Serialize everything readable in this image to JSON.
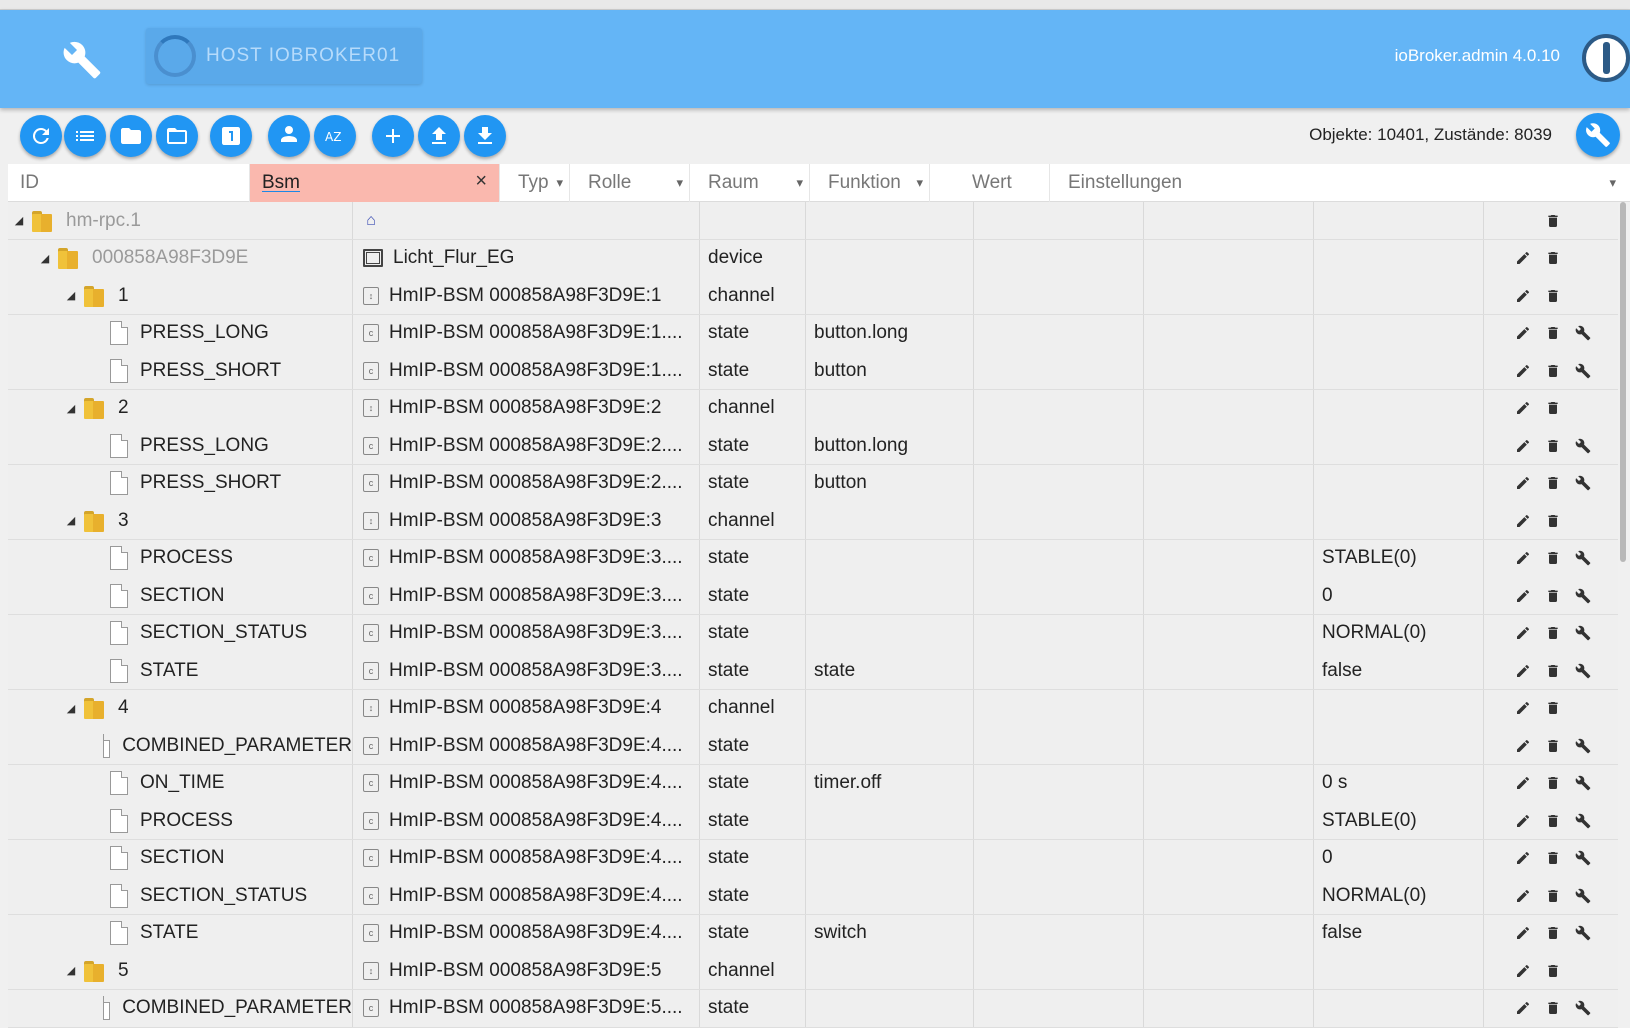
{
  "appbar": {
    "host_label": "HOST IOBROKER01",
    "version": "ioBroker.admin 4.0.10"
  },
  "toolbar": {
    "counts": "Objekte: 10401, Zustände: 8039",
    "buttons": [
      "refresh-icon",
      "list-icon",
      "folder-icon",
      "folder-open-icon",
      "number-one-icon",
      "expert-mode-icon",
      "sort-az-icon",
      "add-icon",
      "upload-icon",
      "download-icon"
    ]
  },
  "filters": {
    "id": "ID",
    "name_value": "Bsm",
    "clear": "×",
    "type": "Typ",
    "role": "Rolle",
    "room": "Raum",
    "function": "Funktion",
    "value": "Wert",
    "settings": "Einstellungen",
    "caret": "▾"
  },
  "rows": [
    {
      "level": 0,
      "kind": "folder",
      "toggle": "◢",
      "id": "hm-rpc.1",
      "muted": true,
      "name_icon": "adapter",
      "name": "",
      "type": "",
      "role": "",
      "value": "",
      "actions": [
        "delete"
      ]
    },
    {
      "level": 1,
      "kind": "folder",
      "toggle": "◢",
      "id": "000858A98F3D9E",
      "muted": true,
      "name_icon": "device",
      "name": "Licht_Flur_EG",
      "type": "device",
      "role": "",
      "value": "",
      "actions": [
        "edit",
        "delete"
      ]
    },
    {
      "level": 2,
      "kind": "folder",
      "toggle": "◢",
      "id": "1",
      "name_icon": "channel",
      "name": "HmIP-BSM 000858A98F3D9E:1",
      "type": "channel",
      "role": "",
      "value": "",
      "actions": [
        "edit",
        "delete"
      ]
    },
    {
      "level": 3,
      "kind": "file",
      "id": "PRESS_LONG",
      "name_icon": "state",
      "name": "HmIP-BSM 000858A98F3D9E:1....",
      "type": "state",
      "role": "button.long",
      "value": "",
      "actions": [
        "edit",
        "delete",
        "settings"
      ]
    },
    {
      "level": 3,
      "kind": "file",
      "id": "PRESS_SHORT",
      "name_icon": "state",
      "name": "HmIP-BSM 000858A98F3D9E:1....",
      "type": "state",
      "role": "button",
      "value": "",
      "actions": [
        "edit",
        "delete",
        "settings"
      ]
    },
    {
      "level": 2,
      "kind": "folder",
      "toggle": "◢",
      "id": "2",
      "name_icon": "channel",
      "name": "HmIP-BSM 000858A98F3D9E:2",
      "type": "channel",
      "role": "",
      "value": "",
      "actions": [
        "edit",
        "delete"
      ]
    },
    {
      "level": 3,
      "kind": "file",
      "id": "PRESS_LONG",
      "name_icon": "state",
      "name": "HmIP-BSM 000858A98F3D9E:2....",
      "type": "state",
      "role": "button.long",
      "value": "",
      "actions": [
        "edit",
        "delete",
        "settings"
      ]
    },
    {
      "level": 3,
      "kind": "file",
      "id": "PRESS_SHORT",
      "name_icon": "state",
      "name": "HmIP-BSM 000858A98F3D9E:2....",
      "type": "state",
      "role": "button",
      "value": "",
      "actions": [
        "edit",
        "delete",
        "settings"
      ]
    },
    {
      "level": 2,
      "kind": "folder",
      "toggle": "◢",
      "id": "3",
      "name_icon": "channel",
      "name": "HmIP-BSM 000858A98F3D9E:3",
      "type": "channel",
      "role": "",
      "value": "",
      "actions": [
        "edit",
        "delete"
      ]
    },
    {
      "level": 3,
      "kind": "file",
      "id": "PROCESS",
      "name_icon": "state",
      "name": "HmIP-BSM 000858A98F3D9E:3....",
      "type": "state",
      "role": "",
      "value": "STABLE(0)",
      "actions": [
        "edit",
        "delete",
        "settings"
      ]
    },
    {
      "level": 3,
      "kind": "file",
      "id": "SECTION",
      "name_icon": "state",
      "name": "HmIP-BSM 000858A98F3D9E:3....",
      "type": "state",
      "role": "",
      "value": "0",
      "actions": [
        "edit",
        "delete",
        "settings"
      ]
    },
    {
      "level": 3,
      "kind": "file",
      "id": "SECTION_STATUS",
      "name_icon": "state",
      "name": "HmIP-BSM 000858A98F3D9E:3....",
      "type": "state",
      "role": "",
      "value": "NORMAL(0)",
      "actions": [
        "edit",
        "delete",
        "settings"
      ]
    },
    {
      "level": 3,
      "kind": "file",
      "id": "STATE",
      "name_icon": "state",
      "name": "HmIP-BSM 000858A98F3D9E:3....",
      "type": "state",
      "role": "state",
      "value": "false",
      "actions": [
        "edit",
        "delete",
        "settings"
      ]
    },
    {
      "level": 2,
      "kind": "folder",
      "toggle": "◢",
      "id": "4",
      "name_icon": "channel",
      "name": "HmIP-BSM 000858A98F3D9E:4",
      "type": "channel",
      "role": "",
      "value": "",
      "actions": [
        "edit",
        "delete"
      ]
    },
    {
      "level": 3,
      "kind": "file",
      "id": "COMBINED_PARAMETER",
      "name_icon": "state",
      "name": "HmIP-BSM 000858A98F3D9E:4....",
      "type": "state",
      "role": "",
      "value": "",
      "actions": [
        "edit",
        "delete",
        "settings"
      ]
    },
    {
      "level": 3,
      "kind": "file",
      "id": "ON_TIME",
      "name_icon": "state",
      "name": "HmIP-BSM 000858A98F3D9E:4....",
      "type": "state",
      "role": "timer.off",
      "value": "0 s",
      "actions": [
        "edit",
        "delete",
        "settings"
      ]
    },
    {
      "level": 3,
      "kind": "file",
      "id": "PROCESS",
      "name_icon": "state",
      "name": "HmIP-BSM 000858A98F3D9E:4....",
      "type": "state",
      "role": "",
      "value": "STABLE(0)",
      "actions": [
        "edit",
        "delete",
        "settings"
      ]
    },
    {
      "level": 3,
      "kind": "file",
      "id": "SECTION",
      "name_icon": "state",
      "name": "HmIP-BSM 000858A98F3D9E:4....",
      "type": "state",
      "role": "",
      "value": "0",
      "actions": [
        "edit",
        "delete",
        "settings"
      ]
    },
    {
      "level": 3,
      "kind": "file",
      "id": "SECTION_STATUS",
      "name_icon": "state",
      "name": "HmIP-BSM 000858A98F3D9E:4....",
      "type": "state",
      "role": "",
      "value": "NORMAL(0)",
      "actions": [
        "edit",
        "delete",
        "settings"
      ]
    },
    {
      "level": 3,
      "kind": "file",
      "id": "STATE",
      "name_icon": "state",
      "name": "HmIP-BSM 000858A98F3D9E:4....",
      "type": "state",
      "role": "switch",
      "value": "false",
      "actions": [
        "edit",
        "delete",
        "settings"
      ]
    },
    {
      "level": 2,
      "kind": "folder",
      "toggle": "◢",
      "id": "5",
      "name_icon": "channel",
      "name": "HmIP-BSM 000858A98F3D9E:5",
      "type": "channel",
      "role": "",
      "value": "",
      "actions": [
        "edit",
        "delete"
      ]
    },
    {
      "level": 3,
      "kind": "file",
      "id": "COMBINED_PARAMETER",
      "name_icon": "state",
      "name": "HmIP-BSM 000858A98F3D9E:5....",
      "type": "state",
      "role": "",
      "value": "",
      "actions": [
        "edit",
        "delete",
        "settings"
      ]
    }
  ],
  "colors": {
    "appbar": "#64b5f6",
    "accent": "#2196f3",
    "filter_active": "#fab8ae"
  }
}
